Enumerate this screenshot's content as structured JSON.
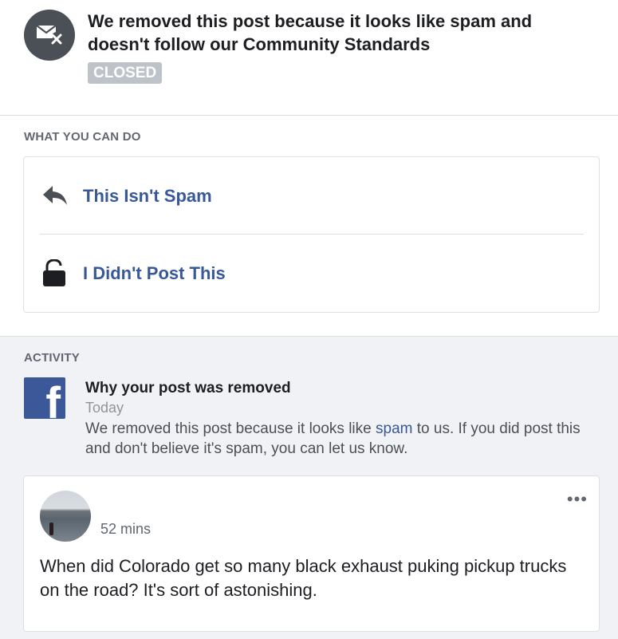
{
  "notice": {
    "title": "We removed this post because it looks like spam and doesn't follow our Community Standards",
    "status_badge": "CLOSED",
    "icon": "envelope-x-icon"
  },
  "what_you_can_do": {
    "heading": "WHAT YOU CAN DO",
    "options": [
      {
        "label": "This Isn't Spam",
        "icon": "reply-arrow-icon"
      },
      {
        "label": "I Didn't Post This",
        "icon": "unlocked-padlock-icon"
      }
    ]
  },
  "activity": {
    "heading": "ACTIVITY",
    "logo_icon": "facebook-logo-icon",
    "logo_letter": "f",
    "title": "Why your post was removed",
    "time": "Today",
    "body_before": "We removed this post because it looks like ",
    "body_link": "spam",
    "body_after": " to us. If you did post this and don't believe it's spam, you can let us know."
  },
  "post": {
    "time": "52 mins",
    "more_icon": "more-options-icon",
    "more_label": "•••",
    "text": "When did Colorado get so many black exhaust puking pickup trucks on the road? It's sort of astonishing."
  }
}
